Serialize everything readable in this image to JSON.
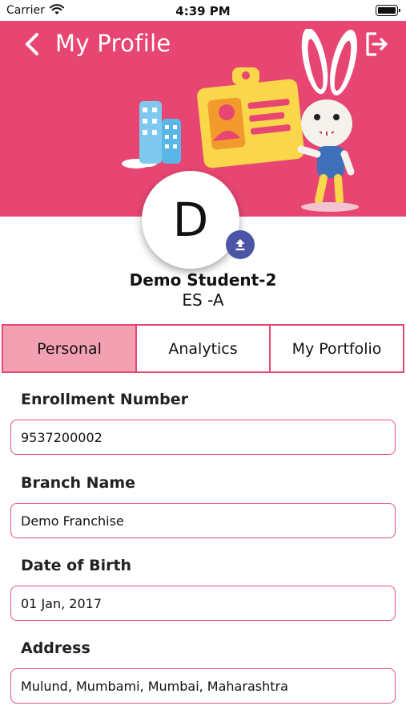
{
  "status_bar": {
    "carrier": "Carrier",
    "time": "4:39 PM"
  },
  "header": {
    "title": "My Profile",
    "background_color": "#e84672",
    "back_icon": "chevron-left-icon",
    "logout_icon": "logout-icon"
  },
  "profile": {
    "avatar_letter": "D",
    "name": "Demo Student-2",
    "class": "ES -A",
    "upload_icon": "upload-icon"
  },
  "tabs": [
    {
      "label": "Personal",
      "active": true
    },
    {
      "label": "Analytics",
      "active": false
    },
    {
      "label": "My Portfolio",
      "active": false
    }
  ],
  "fields": [
    {
      "label": "Enrollment Number",
      "value": "9537200002"
    },
    {
      "label": "Branch Name",
      "value": "Demo Franchise"
    },
    {
      "label": "Date of Birth",
      "value": "01 Jan, 2017"
    },
    {
      "label": "Address",
      "value": "Mulund, Mumbami, Mumbai, Maharashtra"
    }
  ],
  "colors": {
    "accent": "#e84672",
    "active_tab": "#f3a0b3",
    "upload_button": "#4b55a6"
  }
}
